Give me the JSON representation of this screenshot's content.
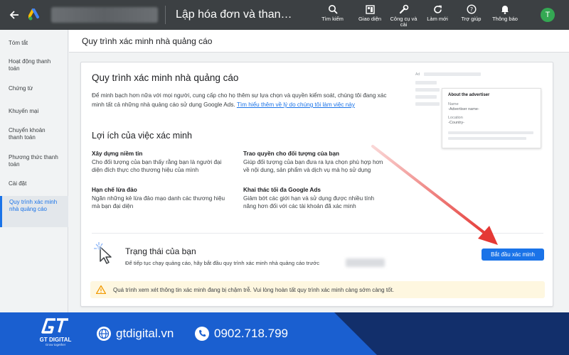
{
  "topbar": {
    "back_icon": "arrow-left-icon",
    "page_heading": "Lập hóa đơn và thanh toán",
    "tools": [
      {
        "label": "Tìm kiếm",
        "icon": "search-icon"
      },
      {
        "label": "Giao diện",
        "icon": "appearance-icon"
      },
      {
        "label": "Công cụ và cài",
        "icon": "wrench-icon"
      },
      {
        "label": "Làm mới",
        "icon": "refresh-icon"
      },
      {
        "label": "Trợ giúp",
        "icon": "help-icon"
      },
      {
        "label": "Thông báo",
        "icon": "bell-icon"
      }
    ],
    "avatar_letter": "T"
  },
  "sidebar": {
    "items": [
      {
        "label": "Tóm tắt"
      },
      {
        "label": "Hoạt động thanh toán"
      },
      {
        "label": "Chứng từ"
      },
      {
        "label": "Khuyến mại"
      },
      {
        "label": "Chuyển khoản thanh toán"
      },
      {
        "label": "Phương thức thanh toán"
      },
      {
        "label": "Cài đặt"
      },
      {
        "label": "Quy trình xác minh nhà quảng cáo"
      }
    ],
    "active_index": 7
  },
  "main": {
    "header": "Quy trình xác minh nhà quảng cáo",
    "card": {
      "title": "Quy trình xác minh nhà quảng cáo",
      "desc": "Để minh bạch hơn nữa với mọi người, cung cấp cho họ thêm sự lựa chọn và quyền kiểm soát, chúng tôi đang xác minh tất cả những nhà quảng cáo sử dụng Google Ads.",
      "link": "Tìm hiểu thêm về lý do chúng tôi làm việc này",
      "benefits_title": "Lợi ích của việc xác minh",
      "benefits": [
        {
          "title": "Xây dựng niềm tin",
          "text": "Cho đối tượng của bạn thấy rằng bạn là người đại diện đích thực cho thương hiệu của mình"
        },
        {
          "title": "Trao quyền cho đối tượng của bạn",
          "text": "Giúp đối tượng của bạn đưa ra lựa chọn phù hợp hơn về nội dung, sản phẩm và dịch vụ mà họ sử dụng"
        },
        {
          "title": "Hạn chế lừa đảo",
          "text": "Ngăn những kẻ lừa đảo mạo danh các thương hiệu mà bạn đại diện"
        },
        {
          "title": "Khai thác tối đa Google Ads",
          "text": "Giảm bớt các giới hạn và sử dụng được nhiều tính năng hơn đối với các tài khoản đã xác minh"
        }
      ],
      "illustration": {
        "ad_label": "Ad",
        "title": "About the advertiser",
        "name_label": "Name",
        "name_value": "-Advertiser name-",
        "location_label": "Location",
        "location_value": "-Country-"
      },
      "status": {
        "title": "Trạng thái của bạn",
        "desc": "Để tiếp tục chạy quảng cáo, hãy bắt đầu quy trình xác minh nhà quảng cáo trước",
        "button": "Bắt đầu xác minh"
      },
      "warning": "Quá trình xem xét thông tin xác minh đang bị chậm trễ. Vui lòng hoàn tất quy trình xác minh càng sớm càng tốt."
    }
  },
  "footer": {
    "brand": "GT DIGITAL",
    "tagline": "Grow together",
    "website": "gtdigital.vn",
    "phone": "0902.718.799"
  },
  "colors": {
    "topbar": "#3c4043",
    "accent": "#1a73e8",
    "arrow": "#e53935",
    "footer": "#1a5fd0",
    "warning_bg": "#fef7e0"
  }
}
